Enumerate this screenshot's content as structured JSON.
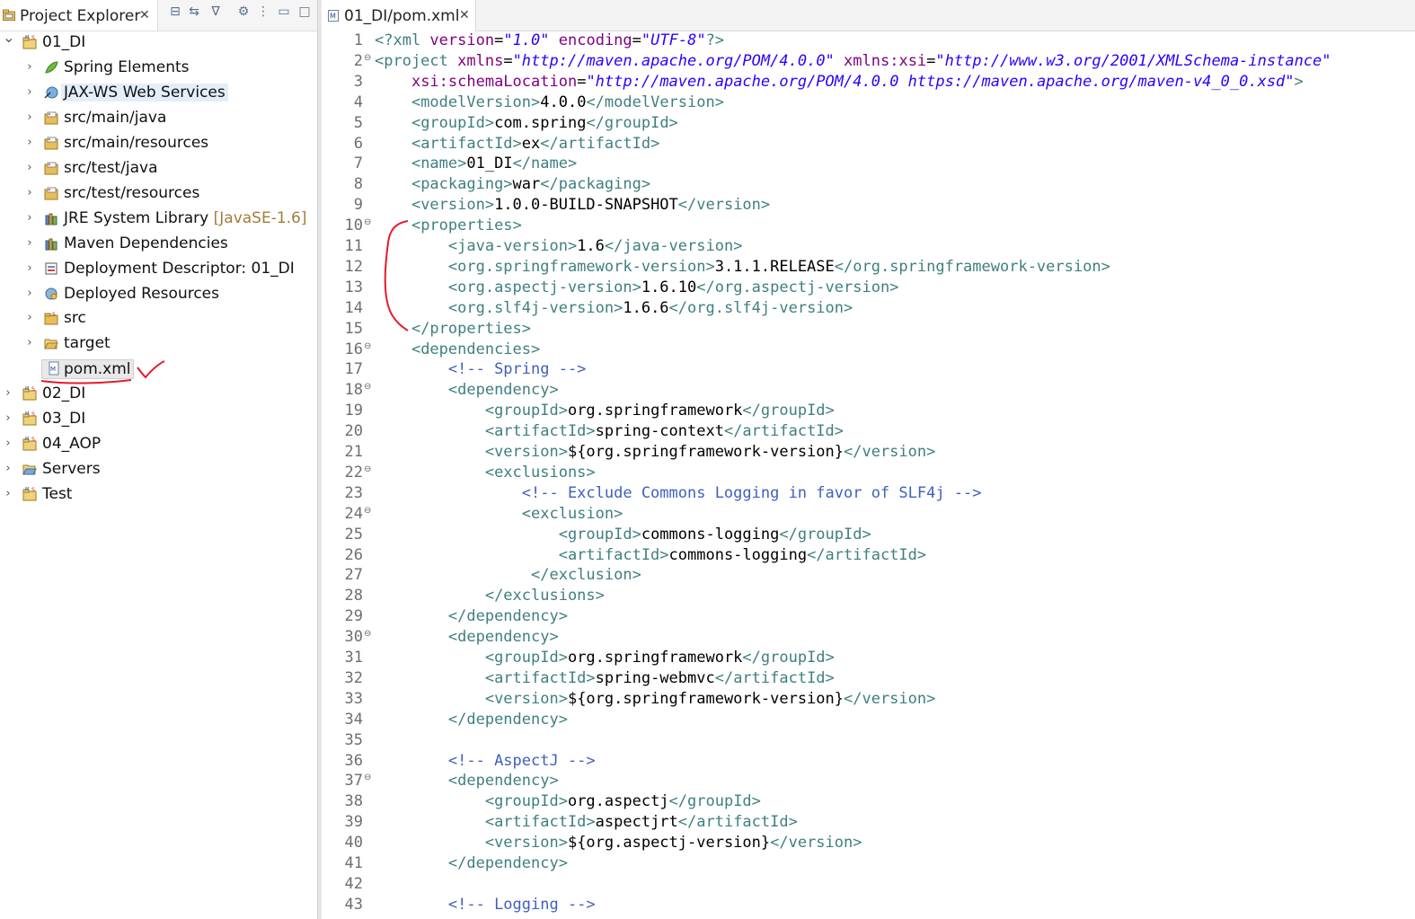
{
  "project_explorer": {
    "title": "Project Explorer",
    "close": "✕",
    "toolbar": [
      {
        "name": "collapse-all-button",
        "glyph": "⊟"
      },
      {
        "name": "link-with-editor-button",
        "glyph": "⇆"
      },
      {
        "name": "filter-button",
        "glyph": "∇"
      },
      {
        "name": "view-settings-button",
        "glyph": "⚙"
      },
      {
        "name": "view-menu-button",
        "glyph": "⋮"
      },
      {
        "name": "minimize-button",
        "glyph": "▭"
      },
      {
        "name": "maximize-button",
        "glyph": "□"
      }
    ],
    "tree": [
      {
        "label": "01_DI",
        "expanded": true,
        "depth": 0,
        "icon": "maven-project-icon"
      },
      {
        "label": "Spring Elements",
        "depth": 1,
        "icon": "spring-leaf-icon",
        "twisty": true
      },
      {
        "label": "JAX-WS Web Services",
        "depth": 1,
        "icon": "web-services-icon",
        "twisty": true,
        "highlight": true
      },
      {
        "label": "src/main/java",
        "depth": 1,
        "icon": "source-folder-icon",
        "twisty": true
      },
      {
        "label": "src/main/resources",
        "depth": 1,
        "icon": "source-folder-icon",
        "twisty": true
      },
      {
        "label": "src/test/java",
        "depth": 1,
        "icon": "source-folder-icon",
        "twisty": true
      },
      {
        "label": "src/test/resources",
        "depth": 1,
        "icon": "source-folder-icon",
        "twisty": true
      },
      {
        "label": "JRE System Library",
        "suffix": "[JavaSE-1.6]",
        "depth": 1,
        "icon": "library-icon",
        "twisty": true
      },
      {
        "label": "Maven Dependencies",
        "depth": 1,
        "icon": "library-icon",
        "twisty": true
      },
      {
        "label": "Deployment Descriptor: 01_DI",
        "depth": 1,
        "icon": "deployment-descriptor-icon",
        "twisty": true
      },
      {
        "label": "Deployed Resources",
        "depth": 1,
        "icon": "deployed-resources-icon",
        "twisty": true
      },
      {
        "label": "src",
        "depth": 1,
        "icon": "folder-icon",
        "twisty": true
      },
      {
        "label": "target",
        "depth": 1,
        "icon": "open-folder-icon",
        "twisty": true
      },
      {
        "label": "pom.xml",
        "depth": 1,
        "icon": "xml-file-icon",
        "twisty": false,
        "selected": true
      },
      {
        "label": "02_DI",
        "depth": 0,
        "icon": "maven-project-icon",
        "twisty": true
      },
      {
        "label": "03_DI",
        "depth": 0,
        "icon": "maven-project-icon",
        "twisty": true
      },
      {
        "label": "04_AOP",
        "depth": 0,
        "icon": "maven-project-icon",
        "twisty": true
      },
      {
        "label": "Servers",
        "depth": 0,
        "icon": "servers-folder-icon",
        "twisty": true
      },
      {
        "label": "Test",
        "depth": 0,
        "icon": "maven-project-icon",
        "twisty": true
      }
    ]
  },
  "editor": {
    "tab_title": "01_DI/pom.xml",
    "close": "✕",
    "lines": [
      {
        "n": "1",
        "segs": [
          [
            "tag",
            "<?xml "
          ],
          [
            "attr",
            "version"
          ],
          [
            "txt",
            "="
          ],
          [
            "val",
            "\"1.0\""
          ],
          [
            "txt",
            " "
          ],
          [
            "attr",
            "encoding"
          ],
          [
            "txt",
            "="
          ],
          [
            "val",
            "\"UTF-8\""
          ],
          [
            "tag",
            "?>"
          ]
        ]
      },
      {
        "n": "2",
        "fold": true,
        "segs": [
          [
            "tag",
            "<project "
          ],
          [
            "attr",
            "xmlns"
          ],
          [
            "txt",
            "="
          ],
          [
            "val",
            "\"http://maven.apache.org/POM/4.0.0\""
          ],
          [
            "txt",
            " "
          ],
          [
            "attr",
            "xmlns:xsi"
          ],
          [
            "txt",
            "="
          ],
          [
            "val",
            "\"http://www.w3.org/2001/XMLSchema-instance\""
          ]
        ]
      },
      {
        "n": "3",
        "segs": [
          [
            "txt",
            "    "
          ],
          [
            "attr",
            "xsi:schemaLocation"
          ],
          [
            "txt",
            "="
          ],
          [
            "val",
            "\"http://maven.apache.org/POM/4.0.0 https://maven.apache.org/maven-v4_0_0.xsd\""
          ],
          [
            "tag",
            ">"
          ]
        ]
      },
      {
        "n": "4",
        "segs": [
          [
            "txt",
            "    "
          ],
          [
            "tag",
            "<modelVersion>"
          ],
          [
            "txt",
            "4.0.0"
          ],
          [
            "tag",
            "</modelVersion>"
          ]
        ]
      },
      {
        "n": "5",
        "segs": [
          [
            "txt",
            "    "
          ],
          [
            "tag",
            "<groupId>"
          ],
          [
            "txt",
            "com.spring"
          ],
          [
            "tag",
            "</groupId>"
          ]
        ]
      },
      {
        "n": "6",
        "segs": [
          [
            "txt",
            "    "
          ],
          [
            "tag",
            "<artifactId>"
          ],
          [
            "txt",
            "ex"
          ],
          [
            "tag",
            "</artifactId>"
          ]
        ]
      },
      {
        "n": "7",
        "segs": [
          [
            "txt",
            "    "
          ],
          [
            "tag",
            "<name>"
          ],
          [
            "txt",
            "01_DI"
          ],
          [
            "tag",
            "</name>"
          ]
        ]
      },
      {
        "n": "8",
        "segs": [
          [
            "txt",
            "    "
          ],
          [
            "tag",
            "<packaging>"
          ],
          [
            "txt",
            "war"
          ],
          [
            "tag",
            "</packaging>"
          ]
        ]
      },
      {
        "n": "9",
        "segs": [
          [
            "txt",
            "    "
          ],
          [
            "tag",
            "<version>"
          ],
          [
            "txt",
            "1.0.0-BUILD-SNAPSHOT"
          ],
          [
            "tag",
            "</version>"
          ]
        ]
      },
      {
        "n": "10",
        "fold": true,
        "segs": [
          [
            "txt",
            "    "
          ],
          [
            "tag",
            "<properties>"
          ]
        ]
      },
      {
        "n": "11",
        "segs": [
          [
            "txt",
            "        "
          ],
          [
            "tag",
            "<java-version>"
          ],
          [
            "txt",
            "1.6"
          ],
          [
            "tag",
            "</java-version>"
          ]
        ]
      },
      {
        "n": "12",
        "segs": [
          [
            "txt",
            "        "
          ],
          [
            "tag",
            "<org.springframework-version>"
          ],
          [
            "txt",
            "3.1.1.RELEASE"
          ],
          [
            "tag",
            "</org.springframework-version>"
          ]
        ]
      },
      {
        "n": "13",
        "segs": [
          [
            "txt",
            "        "
          ],
          [
            "tag",
            "<org.aspectj-version>"
          ],
          [
            "txt",
            "1.6.10"
          ],
          [
            "tag",
            "</org.aspectj-version>"
          ]
        ]
      },
      {
        "n": "14",
        "segs": [
          [
            "txt",
            "        "
          ],
          [
            "tag",
            "<org.slf4j-version>"
          ],
          [
            "txt",
            "1.6.6"
          ],
          [
            "tag",
            "</org.slf4j-version>"
          ]
        ]
      },
      {
        "n": "15",
        "segs": [
          [
            "txt",
            "    "
          ],
          [
            "tag",
            "</properties>"
          ]
        ]
      },
      {
        "n": "16",
        "fold": true,
        "segs": [
          [
            "txt",
            "    "
          ],
          [
            "tag",
            "<dependencies>"
          ]
        ]
      },
      {
        "n": "17",
        "segs": [
          [
            "txt",
            "        "
          ],
          [
            "com",
            "<!-- Spring -->"
          ]
        ]
      },
      {
        "n": "18",
        "fold": true,
        "segs": [
          [
            "txt",
            "        "
          ],
          [
            "tag",
            "<dependency>"
          ]
        ]
      },
      {
        "n": "19",
        "segs": [
          [
            "txt",
            "            "
          ],
          [
            "tag",
            "<groupId>"
          ],
          [
            "txt",
            "org.springframework"
          ],
          [
            "tag",
            "</groupId>"
          ]
        ]
      },
      {
        "n": "20",
        "segs": [
          [
            "txt",
            "            "
          ],
          [
            "tag",
            "<artifactId>"
          ],
          [
            "txt",
            "spring-context"
          ],
          [
            "tag",
            "</artifactId>"
          ]
        ]
      },
      {
        "n": "21",
        "segs": [
          [
            "txt",
            "            "
          ],
          [
            "tag",
            "<version>"
          ],
          [
            "txt",
            "${org.springframework-version}"
          ],
          [
            "tag",
            "</version>"
          ]
        ]
      },
      {
        "n": "22",
        "fold": true,
        "segs": [
          [
            "txt",
            "            "
          ],
          [
            "tag",
            "<exclusions>"
          ]
        ]
      },
      {
        "n": "23",
        "segs": [
          [
            "txt",
            "                "
          ],
          [
            "com",
            "<!-- Exclude Commons Logging in favor of SLF4j -->"
          ]
        ]
      },
      {
        "n": "24",
        "fold": true,
        "segs": [
          [
            "txt",
            "                "
          ],
          [
            "tag",
            "<exclusion>"
          ]
        ]
      },
      {
        "n": "25",
        "segs": [
          [
            "txt",
            "                    "
          ],
          [
            "tag",
            "<groupId>"
          ],
          [
            "txt",
            "commons-logging"
          ],
          [
            "tag",
            "</groupId>"
          ]
        ]
      },
      {
        "n": "26",
        "segs": [
          [
            "txt",
            "                    "
          ],
          [
            "tag",
            "<artifactId>"
          ],
          [
            "txt",
            "commons-logging"
          ],
          [
            "tag",
            "</artifactId>"
          ]
        ]
      },
      {
        "n": "27",
        "segs": [
          [
            "txt",
            "                 "
          ],
          [
            "tag",
            "</exclusion>"
          ]
        ]
      },
      {
        "n": "28",
        "segs": [
          [
            "txt",
            "            "
          ],
          [
            "tag",
            "</exclusions>"
          ]
        ]
      },
      {
        "n": "29",
        "segs": [
          [
            "txt",
            "        "
          ],
          [
            "tag",
            "</dependency>"
          ]
        ]
      },
      {
        "n": "30",
        "fold": true,
        "segs": [
          [
            "txt",
            "        "
          ],
          [
            "tag",
            "<dependency>"
          ]
        ]
      },
      {
        "n": "31",
        "segs": [
          [
            "txt",
            "            "
          ],
          [
            "tag",
            "<groupId>"
          ],
          [
            "txt",
            "org.springframework"
          ],
          [
            "tag",
            "</groupId>"
          ]
        ]
      },
      {
        "n": "32",
        "segs": [
          [
            "txt",
            "            "
          ],
          [
            "tag",
            "<artifactId>"
          ],
          [
            "txt",
            "spring-webmvc"
          ],
          [
            "tag",
            "</artifactId>"
          ]
        ]
      },
      {
        "n": "33",
        "segs": [
          [
            "txt",
            "            "
          ],
          [
            "tag",
            "<version>"
          ],
          [
            "txt",
            "${org.springframework-version}"
          ],
          [
            "tag",
            "</version>"
          ]
        ]
      },
      {
        "n": "34",
        "segs": [
          [
            "txt",
            "        "
          ],
          [
            "tag",
            "</dependency>"
          ]
        ]
      },
      {
        "n": "35",
        "segs": []
      },
      {
        "n": "36",
        "segs": [
          [
            "txt",
            "        "
          ],
          [
            "com",
            "<!-- AspectJ -->"
          ]
        ]
      },
      {
        "n": "37",
        "fold": true,
        "segs": [
          [
            "txt",
            "        "
          ],
          [
            "tag",
            "<dependency>"
          ]
        ]
      },
      {
        "n": "38",
        "segs": [
          [
            "txt",
            "            "
          ],
          [
            "tag",
            "<groupId>"
          ],
          [
            "txt",
            "org.aspectj"
          ],
          [
            "tag",
            "</groupId>"
          ]
        ]
      },
      {
        "n": "39",
        "segs": [
          [
            "txt",
            "            "
          ],
          [
            "tag",
            "<artifactId>"
          ],
          [
            "txt",
            "aspectjrt"
          ],
          [
            "tag",
            "</artifactId>"
          ]
        ]
      },
      {
        "n": "40",
        "segs": [
          [
            "txt",
            "            "
          ],
          [
            "tag",
            "<version>"
          ],
          [
            "txt",
            "${org.aspectj-version}"
          ],
          [
            "tag",
            "</version>"
          ]
        ]
      },
      {
        "n": "41",
        "segs": [
          [
            "txt",
            "        "
          ],
          [
            "tag",
            "</dependency>"
          ]
        ]
      },
      {
        "n": "42",
        "segs": []
      },
      {
        "n": "43",
        "segs": [
          [
            "txt",
            "        "
          ],
          [
            "com",
            "<!-- Logging -->"
          ]
        ]
      }
    ]
  },
  "colors": {
    "tag": "#3f7f7f",
    "attr": "#7f007f",
    "val": "#2a00ff",
    "comment": "#3f5fbf",
    "annotation": "#e8192c"
  }
}
